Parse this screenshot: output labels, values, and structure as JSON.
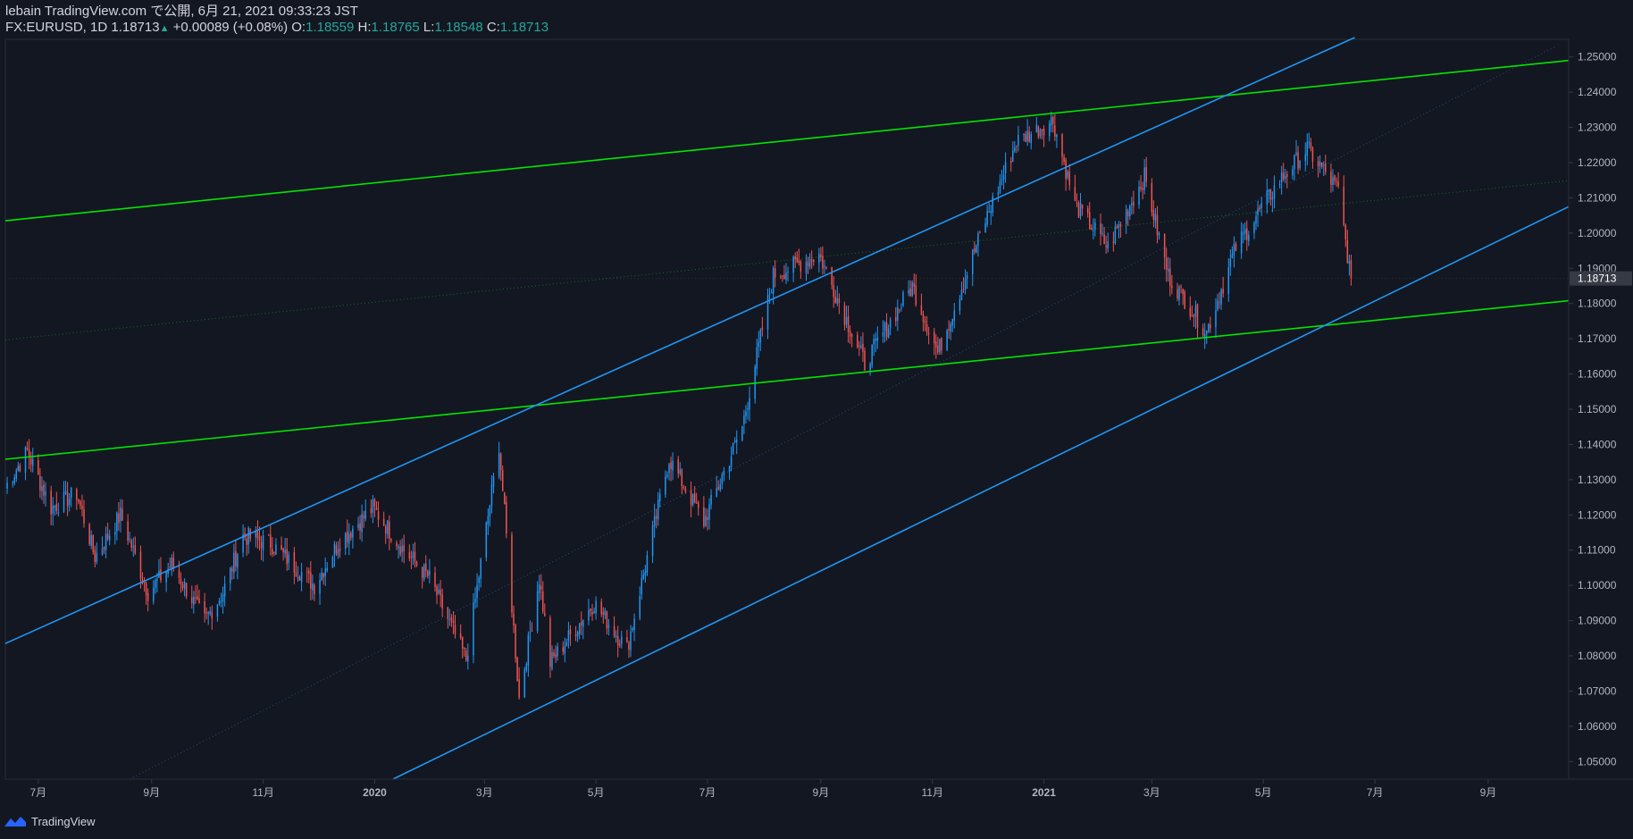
{
  "header": {
    "published": "lebain TradingView.com で公開, 6月 21, 2021 09:33:23 JST",
    "symbol": "FX:EURUSD, 1D",
    "last": "1.18713",
    "change": "+0.00089 (+0.08%)",
    "o_label": "O:",
    "o_val": "1.18559",
    "h_label": "H:",
    "h_val": "1.18765",
    "l_label": "L:",
    "l_val": "1.18548",
    "c_label": "C:",
    "c_val": "1.18713"
  },
  "footer": {
    "brand": "TradingView"
  },
  "colors": {
    "background": "#131722",
    "up_candle": "#2196f3",
    "down_candle": "#ef5350",
    "channel_blue": "#2196f3",
    "channel_green": "#00e600",
    "axis_text": "#b2b5be",
    "price_badge": "#363a45"
  },
  "chart_data": {
    "type": "candlestick",
    "symbol": "FX:EURUSD",
    "interval": "1D",
    "last_price": "1.18713",
    "ylim": [
      1.045,
      1.255
    ],
    "y_ticks": [
      "1.25000",
      "1.24000",
      "1.23000",
      "1.22000",
      "1.21000",
      "1.20000",
      "1.19000",
      "1.18000",
      "1.17000",
      "1.16000",
      "1.15000",
      "1.14000",
      "1.13000",
      "1.12000",
      "1.11000",
      "1.10000",
      "1.09000",
      "1.08000",
      "1.07000",
      "1.06000",
      "1.05000"
    ],
    "x_ticks": [
      "7月",
      "9月",
      "11月",
      "2020",
      "3月",
      "5月",
      "7月",
      "9月",
      "11月",
      "2021",
      "3月",
      "5月",
      "7月",
      "9月"
    ],
    "x_tick_bold": [
      false,
      false,
      false,
      true,
      false,
      false,
      false,
      false,
      false,
      true,
      false,
      false,
      false,
      false
    ],
    "x_range": [
      "2019-06-13",
      "2021-10-15"
    ],
    "x_tick_dates": [
      "2019-07-01",
      "2019-09-01",
      "2019-11-01",
      "2020-01-01",
      "2020-03-01",
      "2020-05-01",
      "2020-07-01",
      "2020-09-01",
      "2020-11-01",
      "2021-01-01",
      "2021-03-01",
      "2021-05-01",
      "2021-07-01",
      "2021-09-01"
    ],
    "close_path": [
      [
        "2019-06-13",
        1.128
      ],
      [
        "2019-06-25",
        1.138
      ],
      [
        "2019-07-08",
        1.122
      ],
      [
        "2019-07-22",
        1.126
      ],
      [
        "2019-08-01",
        1.108
      ],
      [
        "2019-08-15",
        1.12
      ],
      [
        "2019-08-30",
        1.098
      ],
      [
        "2019-09-12",
        1.106
      ],
      [
        "2019-09-30",
        1.09
      ],
      [
        "2019-10-10",
        1.098
      ],
      [
        "2019-10-21",
        1.114
      ],
      [
        "2019-11-05",
        1.112
      ],
      [
        "2019-11-29",
        1.1
      ],
      [
        "2019-12-12",
        1.112
      ],
      [
        "2019-12-31",
        1.122
      ],
      [
        "2020-01-17",
        1.11
      ],
      [
        "2020-01-31",
        1.102
      ],
      [
        "2020-02-20",
        1.079
      ],
      [
        "2020-03-09",
        1.14
      ],
      [
        "2020-03-20",
        1.068
      ],
      [
        "2020-03-31",
        1.102
      ],
      [
        "2020-04-06",
        1.078
      ],
      [
        "2020-04-30",
        1.095
      ],
      [
        "2020-05-18",
        1.082
      ],
      [
        "2020-06-10",
        1.136
      ],
      [
        "2020-06-29",
        1.118
      ],
      [
        "2020-07-20",
        1.145
      ],
      [
        "2020-08-06",
        1.188
      ],
      [
        "2020-08-31",
        1.194
      ],
      [
        "2020-09-25",
        1.163
      ],
      [
        "2020-10-21",
        1.185
      ],
      [
        "2020-11-04",
        1.166
      ],
      [
        "2020-12-01",
        1.205
      ],
      [
        "2020-12-17",
        1.226
      ],
      [
        "2021-01-06",
        1.232
      ],
      [
        "2021-01-18",
        1.208
      ],
      [
        "2021-02-05",
        1.196
      ],
      [
        "2021-02-25",
        1.216
      ],
      [
        "2021-03-10",
        1.188
      ],
      [
        "2021-03-31",
        1.172
      ],
      [
        "2021-04-16",
        1.196
      ],
      [
        "2021-05-10",
        1.215
      ],
      [
        "2021-05-25",
        1.224
      ],
      [
        "2021-06-11",
        1.212
      ],
      [
        "2021-06-18",
        1.187
      ]
    ],
    "lines": [
      {
        "name": "green-channel-top",
        "color": "green",
        "style": "solid",
        "p1": [
          "2019-06-13",
          1.2035
        ],
        "p2": [
          "2021-10-15",
          1.249
        ]
      },
      {
        "name": "green-channel-bottom",
        "color": "green",
        "style": "solid",
        "p1": [
          "2019-06-13",
          1.1358
        ],
        "p2": [
          "2021-10-15",
          1.1808
        ]
      },
      {
        "name": "green-channel-mid",
        "color": "green",
        "style": "dotted",
        "p1": [
          "2019-06-13",
          1.1697
        ],
        "p2": [
          "2021-10-15",
          1.2149
        ]
      },
      {
        "name": "blue-channel-top",
        "color": "blue",
        "style": "solid",
        "p1": [
          "2019-06-13",
          1.0835
        ],
        "p2": [
          "2021-06-20",
          1.2555
        ]
      },
      {
        "name": "blue-channel-bottom",
        "color": "blue",
        "style": "solid",
        "p1": [
          "2020-01-11",
          1.045
        ],
        "p2": [
          "2021-10-15",
          1.2075
        ]
      },
      {
        "name": "blue-channel-mid",
        "color": "blue",
        "style": "dotted",
        "p1": [
          "2019-08-20",
          1.045
        ],
        "p2": [
          "2021-10-08",
          1.253
        ]
      }
    ]
  }
}
